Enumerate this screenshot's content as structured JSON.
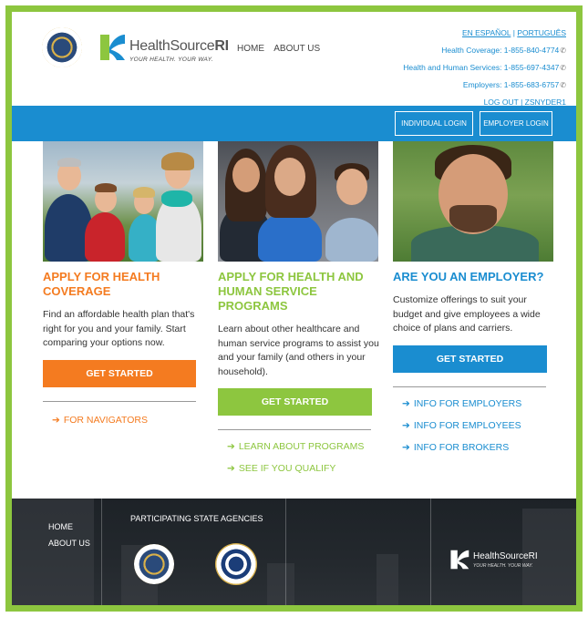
{
  "header": {
    "logo_name": "HealthSource",
    "logo_suffix": "RI",
    "logo_tagline": "YOUR HEALTH. YOUR WAY.",
    "nav": [
      "HOME",
      "ABOUT US"
    ],
    "lang_es": "EN ESPAÑOL",
    "lang_sep": "|",
    "lang_pt": "PORTUGUÊS",
    "phones": [
      "Health Coverage: 1-855-840-4774",
      "Health and Human Services: 1-855-697-4347",
      "Employers: 1-855-683-6757"
    ],
    "logout": "LOG OUT",
    "acct_sep": "|",
    "username": "ZSNYDER1",
    "phone_icon": "phone-icon"
  },
  "loginbar": {
    "individual": "INDIVIDUAL LOGIN",
    "employer": "EMPLOYER LOGIN"
  },
  "columns": [
    {
      "title": "APPLY FOR HEALTH COVERAGE",
      "body": "Find an affordable health plan that's right for you and your family. Start comparing your options now.",
      "cta": "GET STARTED",
      "links": [
        "FOR NAVIGATORS"
      ]
    },
    {
      "title": "APPLY FOR HEALTH AND HUMAN SERVICE PROGRAMS",
      "body": "Learn about other healthcare and human service programs to assist you and your family (and others in your household).",
      "cta": "GET STARTED",
      "links": [
        "LEARN ABOUT PROGRAMS",
        "SEE IF YOU QUALIFY"
      ]
    },
    {
      "title": "ARE YOU AN EMPLOYER?",
      "body": "Customize offerings to suit your budget and give employees a wide choice of plans and carriers.",
      "cta": "GET STARTED",
      "links": [
        "INFO FOR EMPLOYERS",
        "INFO FOR EMPLOYEES",
        "INFO FOR BROKERS"
      ]
    }
  ],
  "arrow": "➔",
  "footer": {
    "nav": [
      "HOME",
      "ABOUT US"
    ],
    "agencies_title": "PARTICIPATING STATE AGENCIES",
    "logo_name": "HealthSource",
    "logo_suffix": "RI",
    "logo_tagline": "YOUR HEALTH. YOUR WAY."
  },
  "colors": {
    "frame": "#8dc63f",
    "blue": "#1a8dd0",
    "orange": "#f47b20",
    "green": "#8dc63f"
  }
}
